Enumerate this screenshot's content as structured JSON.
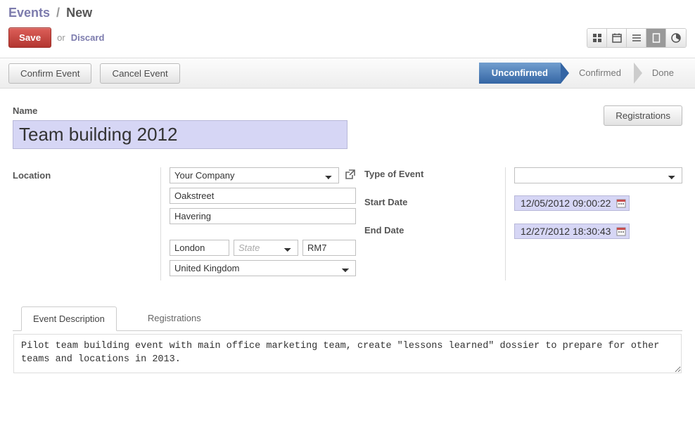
{
  "breadcrumb": {
    "root": "Events",
    "current": "New"
  },
  "toolbar": {
    "save": "Save",
    "or": "or",
    "discard": "Discard"
  },
  "actions": {
    "confirm": "Confirm Event",
    "cancel": "Cancel Event"
  },
  "status": {
    "unconfirmed": "Unconfirmed",
    "confirmed": "Confirmed",
    "done": "Done"
  },
  "buttons": {
    "registrations": "Registrations"
  },
  "labels": {
    "name": "Name",
    "location": "Location",
    "type_of_event": "Type of Event",
    "start_date": "Start Date",
    "end_date": "End Date"
  },
  "form": {
    "name": "Team building 2012",
    "company": "Your Company",
    "street": "Oakstreet",
    "street2": "Havering",
    "city": "London",
    "state_placeholder": "State",
    "zip": "RM7",
    "country": "United Kingdom",
    "type_of_event": "",
    "start_date": "12/05/2012 09:00:22",
    "end_date": "12/27/2012 18:30:43"
  },
  "tabs": {
    "description": "Event Description",
    "registrations": "Registrations"
  },
  "description_text": "Pilot team building event with main office marketing team, create \"lessons learned\" dossier to prepare for other teams and locations in 2013."
}
